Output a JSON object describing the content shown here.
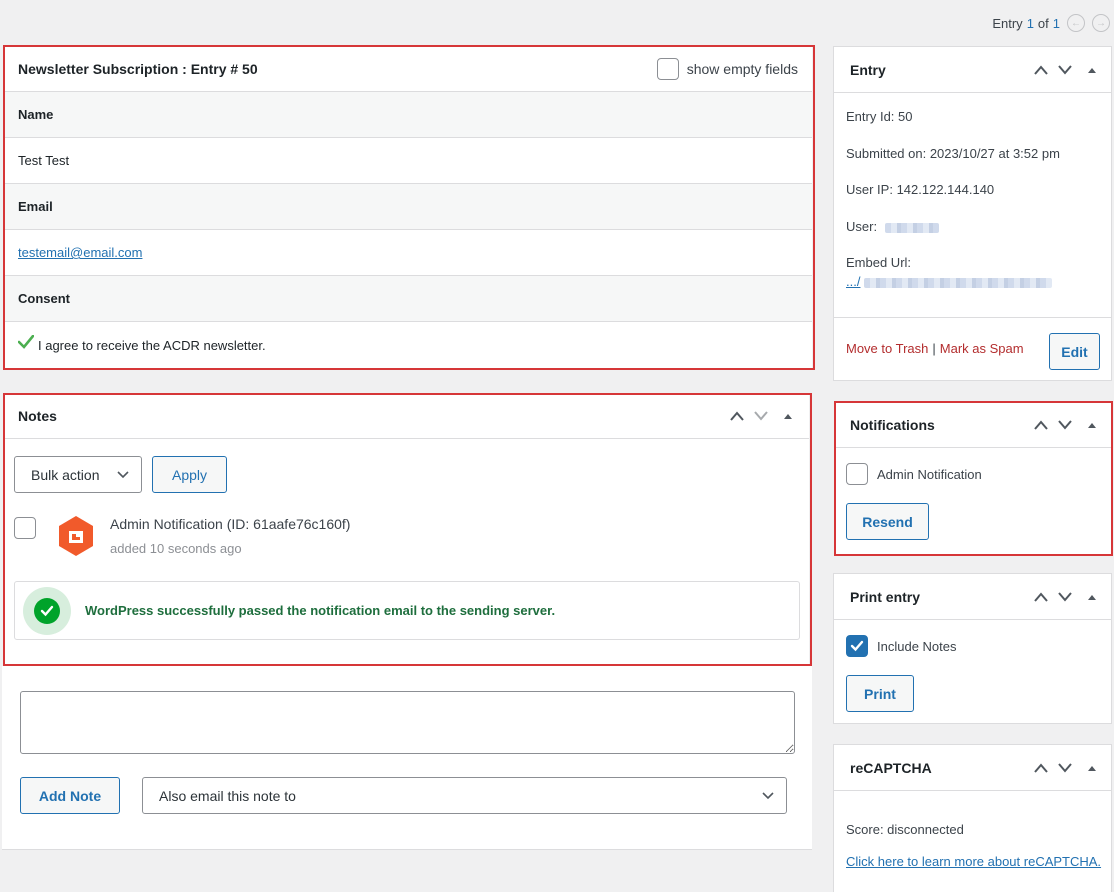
{
  "pager": {
    "prefix": "Entry",
    "current": "1",
    "of": "of",
    "total": "1"
  },
  "entry_panel": {
    "title": "Newsletter Subscription : Entry # 50",
    "show_empty_label": "show empty fields",
    "fields": [
      {
        "label": "Name",
        "value": "Test Test"
      },
      {
        "label": "Email",
        "value": "testemail@email.com"
      },
      {
        "label": "Consent",
        "value": "I agree to receive the ACDR newsletter."
      }
    ]
  },
  "notes_panel": {
    "title": "Notes",
    "bulk_action": "Bulk action",
    "apply": "Apply",
    "note_title": "Admin Notification (ID: 61aafe76c160f)",
    "note_time": "added 10 seconds ago",
    "success_message": "WordPress successfully passed the notification email to the sending server."
  },
  "add_note": {
    "add_button": "Add Note",
    "email_select": "Also email this note to"
  },
  "entry_side": {
    "title": "Entry",
    "entry_id": "Entry Id: 50",
    "submitted": "Submitted on: 2023/10/27 at 3:52 pm",
    "user_ip": "User IP: 142.122.144.140",
    "user": "User:",
    "embed_url": "Embed Url:",
    "embed_prefix": ".../",
    "trash": "Move to Trash",
    "separator": "|",
    "spam": "Mark as Spam",
    "edit": "Edit"
  },
  "notifications_side": {
    "title": "Notifications",
    "admin_notification": "Admin Notification",
    "resend": "Resend"
  },
  "print_side": {
    "title": "Print entry",
    "include_notes": "Include Notes",
    "print": "Print"
  },
  "recaptcha_side": {
    "title": "reCAPTCHA",
    "score": "Score: disconnected",
    "learn_more": "Click here to learn more about reCAPTCHA."
  },
  "colors": {
    "accent": "#2271b1",
    "highlight_border": "#d63638",
    "success": "#00a32a",
    "danger_link": "#b32d2e",
    "gf_logo": "#f15a2b"
  }
}
